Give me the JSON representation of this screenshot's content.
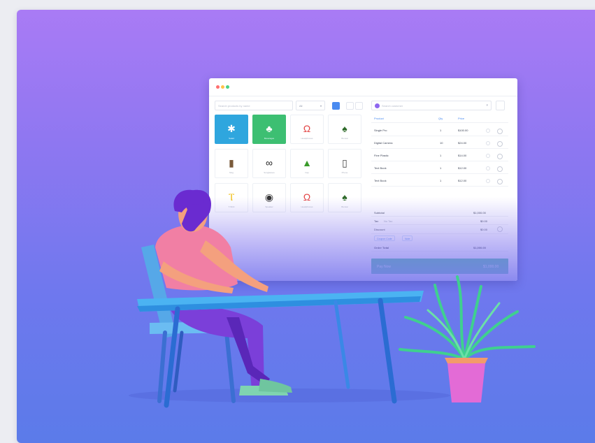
{
  "pos_window": {
    "window_dots": [
      "#ff6f6f",
      "#ffc24a",
      "#4cd185"
    ],
    "search_placeholder": "Search products by name",
    "category_select": "All",
    "customer_placeholder": "Search customer",
    "tiles": [
      {
        "label": "Salad",
        "icon": "snowflake-icon",
        "style": "blue"
      },
      {
        "label": "Beverages",
        "icon": "tree-icon",
        "style": "green"
      },
      {
        "label": "Headphones",
        "icon": "headphones-icon",
        "style": "plain"
      },
      {
        "label": "Bonsai",
        "icon": "plant-icon",
        "style": "plain"
      },
      {
        "label": "Mug",
        "icon": "mug-icon",
        "style": "plain"
      },
      {
        "label": "Sunglasses",
        "icon": "sunglasses-icon",
        "style": "plain"
      },
      {
        "label": "Cap",
        "icon": "cap-icon",
        "style": "plain"
      },
      {
        "label": "Phone",
        "icon": "phone-icon",
        "style": "plain"
      },
      {
        "label": "T-Shirt",
        "icon": "tshirt-icon",
        "style": "plain"
      },
      {
        "label": "Speaker",
        "icon": "speaker-icon",
        "style": "plain"
      },
      {
        "label": "Headphones",
        "icon": "headphones-icon",
        "style": "plain"
      },
      {
        "label": "Bonsai",
        "icon": "plant-icon",
        "style": "plain"
      }
    ],
    "cart_headers": {
      "product": "Product",
      "qty": "Qty",
      "price": "Price"
    },
    "cart_rows": [
      {
        "product": "Single Pro",
        "qty": "1",
        "price": "$100.00"
      },
      {
        "product": "Digital Camera",
        "qty": "10",
        "price": "$24.00"
      },
      {
        "product": "Fine Plastic",
        "qty": "1",
        "price": "$14.00"
      },
      {
        "product": "Text Book",
        "qty": "1",
        "price": "$12.00"
      },
      {
        "product": "Text Book",
        "qty": "1",
        "price": "$12.00"
      }
    ],
    "subtotal_label": "Subtotal",
    "subtotal_value": "$1,000.00",
    "tax_label": "Tax",
    "tax_note": "No Tax",
    "tax_value": "$0.00",
    "discount_label": "Discount",
    "discount_value": "$0.00",
    "coupon_button": "Coupon Code",
    "note_button": "Note",
    "order_total_label": "Order Total",
    "order_total_value": "$1,000.00",
    "pay_label": "Pay Now",
    "pay_value": "$1,000.00"
  },
  "colors": {
    "bg_top": "#a97bf5",
    "bg_bottom": "#5b7be9",
    "accent_blue": "#4a8bf0",
    "pay_green": "#29b88c",
    "table": "#4bb3f2",
    "pot": "#e36bd6"
  }
}
